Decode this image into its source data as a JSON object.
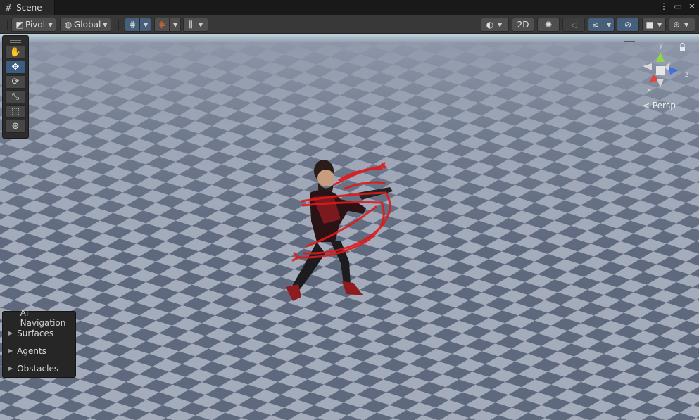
{
  "tab": {
    "icon": "grid-icon",
    "title": "Scene"
  },
  "window_controls": {
    "menu_icon": "⋮",
    "maximize_icon": "▭",
    "close_icon": "✕"
  },
  "toolbar": {
    "pivot_label": "Pivot",
    "global_label": "Global",
    "mode_2d_label": "2D"
  },
  "tools": [
    "hand-tool",
    "move-tool",
    "rotate-tool",
    "scale-tool",
    "rect-tool",
    "transform-tool"
  ],
  "ai_navigation": {
    "title": "AI Navigation",
    "items": [
      {
        "label": "Surfaces"
      },
      {
        "label": "Agents"
      },
      {
        "label": "Obstacles"
      }
    ]
  },
  "gizmo": {
    "y_label": "y",
    "x_label": "x",
    "z_label": "z",
    "persp_label": "< Persp"
  },
  "colors": {
    "toolbar_bg": "#383838",
    "active_blue": "#46607c",
    "floor_light": "#9ea6b6",
    "floor_dark": "#5c6679",
    "axis_x": "#e0443b",
    "axis_y": "#8fd64d",
    "axis_z": "#3f6fe0",
    "gizmo_trail": "#e01a1a"
  }
}
